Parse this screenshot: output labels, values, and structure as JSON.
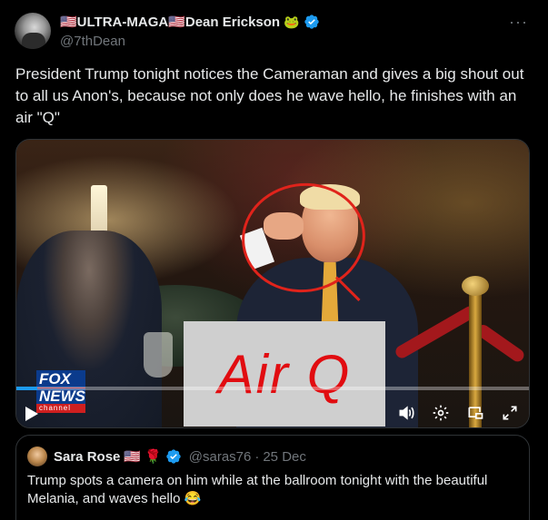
{
  "author": {
    "display_name": "🇺🇸ULTRA-MAGA🇺🇸Dean Erickson",
    "emoji": "🐸",
    "handle": "@7thDean"
  },
  "more_label": "···",
  "tweet_text": "President Trump tonight notices the Cameraman and gives a big shout out to all us Anon's, because not only does he wave hello, he finishes with an air \"Q\"",
  "media": {
    "overlay_text": "Air Q",
    "logo": {
      "fox": "FOX",
      "news": "NEWS",
      "channel": "channel"
    },
    "progress": 0.04,
    "colors": {
      "accent": "#1d9bf0",
      "annotation": "#e0231b"
    },
    "controls": [
      "play-icon",
      "volume-icon",
      "settings-icon",
      "picture-in-picture-icon",
      "fullscreen-icon"
    ]
  },
  "quote": {
    "display_name": "Sara Rose",
    "flag_emoji": "🇺🇸",
    "rose_emoji": "🌹",
    "handle": "@saras76",
    "dot": "·",
    "date": "25 Dec",
    "text": "Trump spots a camera on him while at the ballroom tonight with the beautiful Melania, and waves hello 😂"
  }
}
